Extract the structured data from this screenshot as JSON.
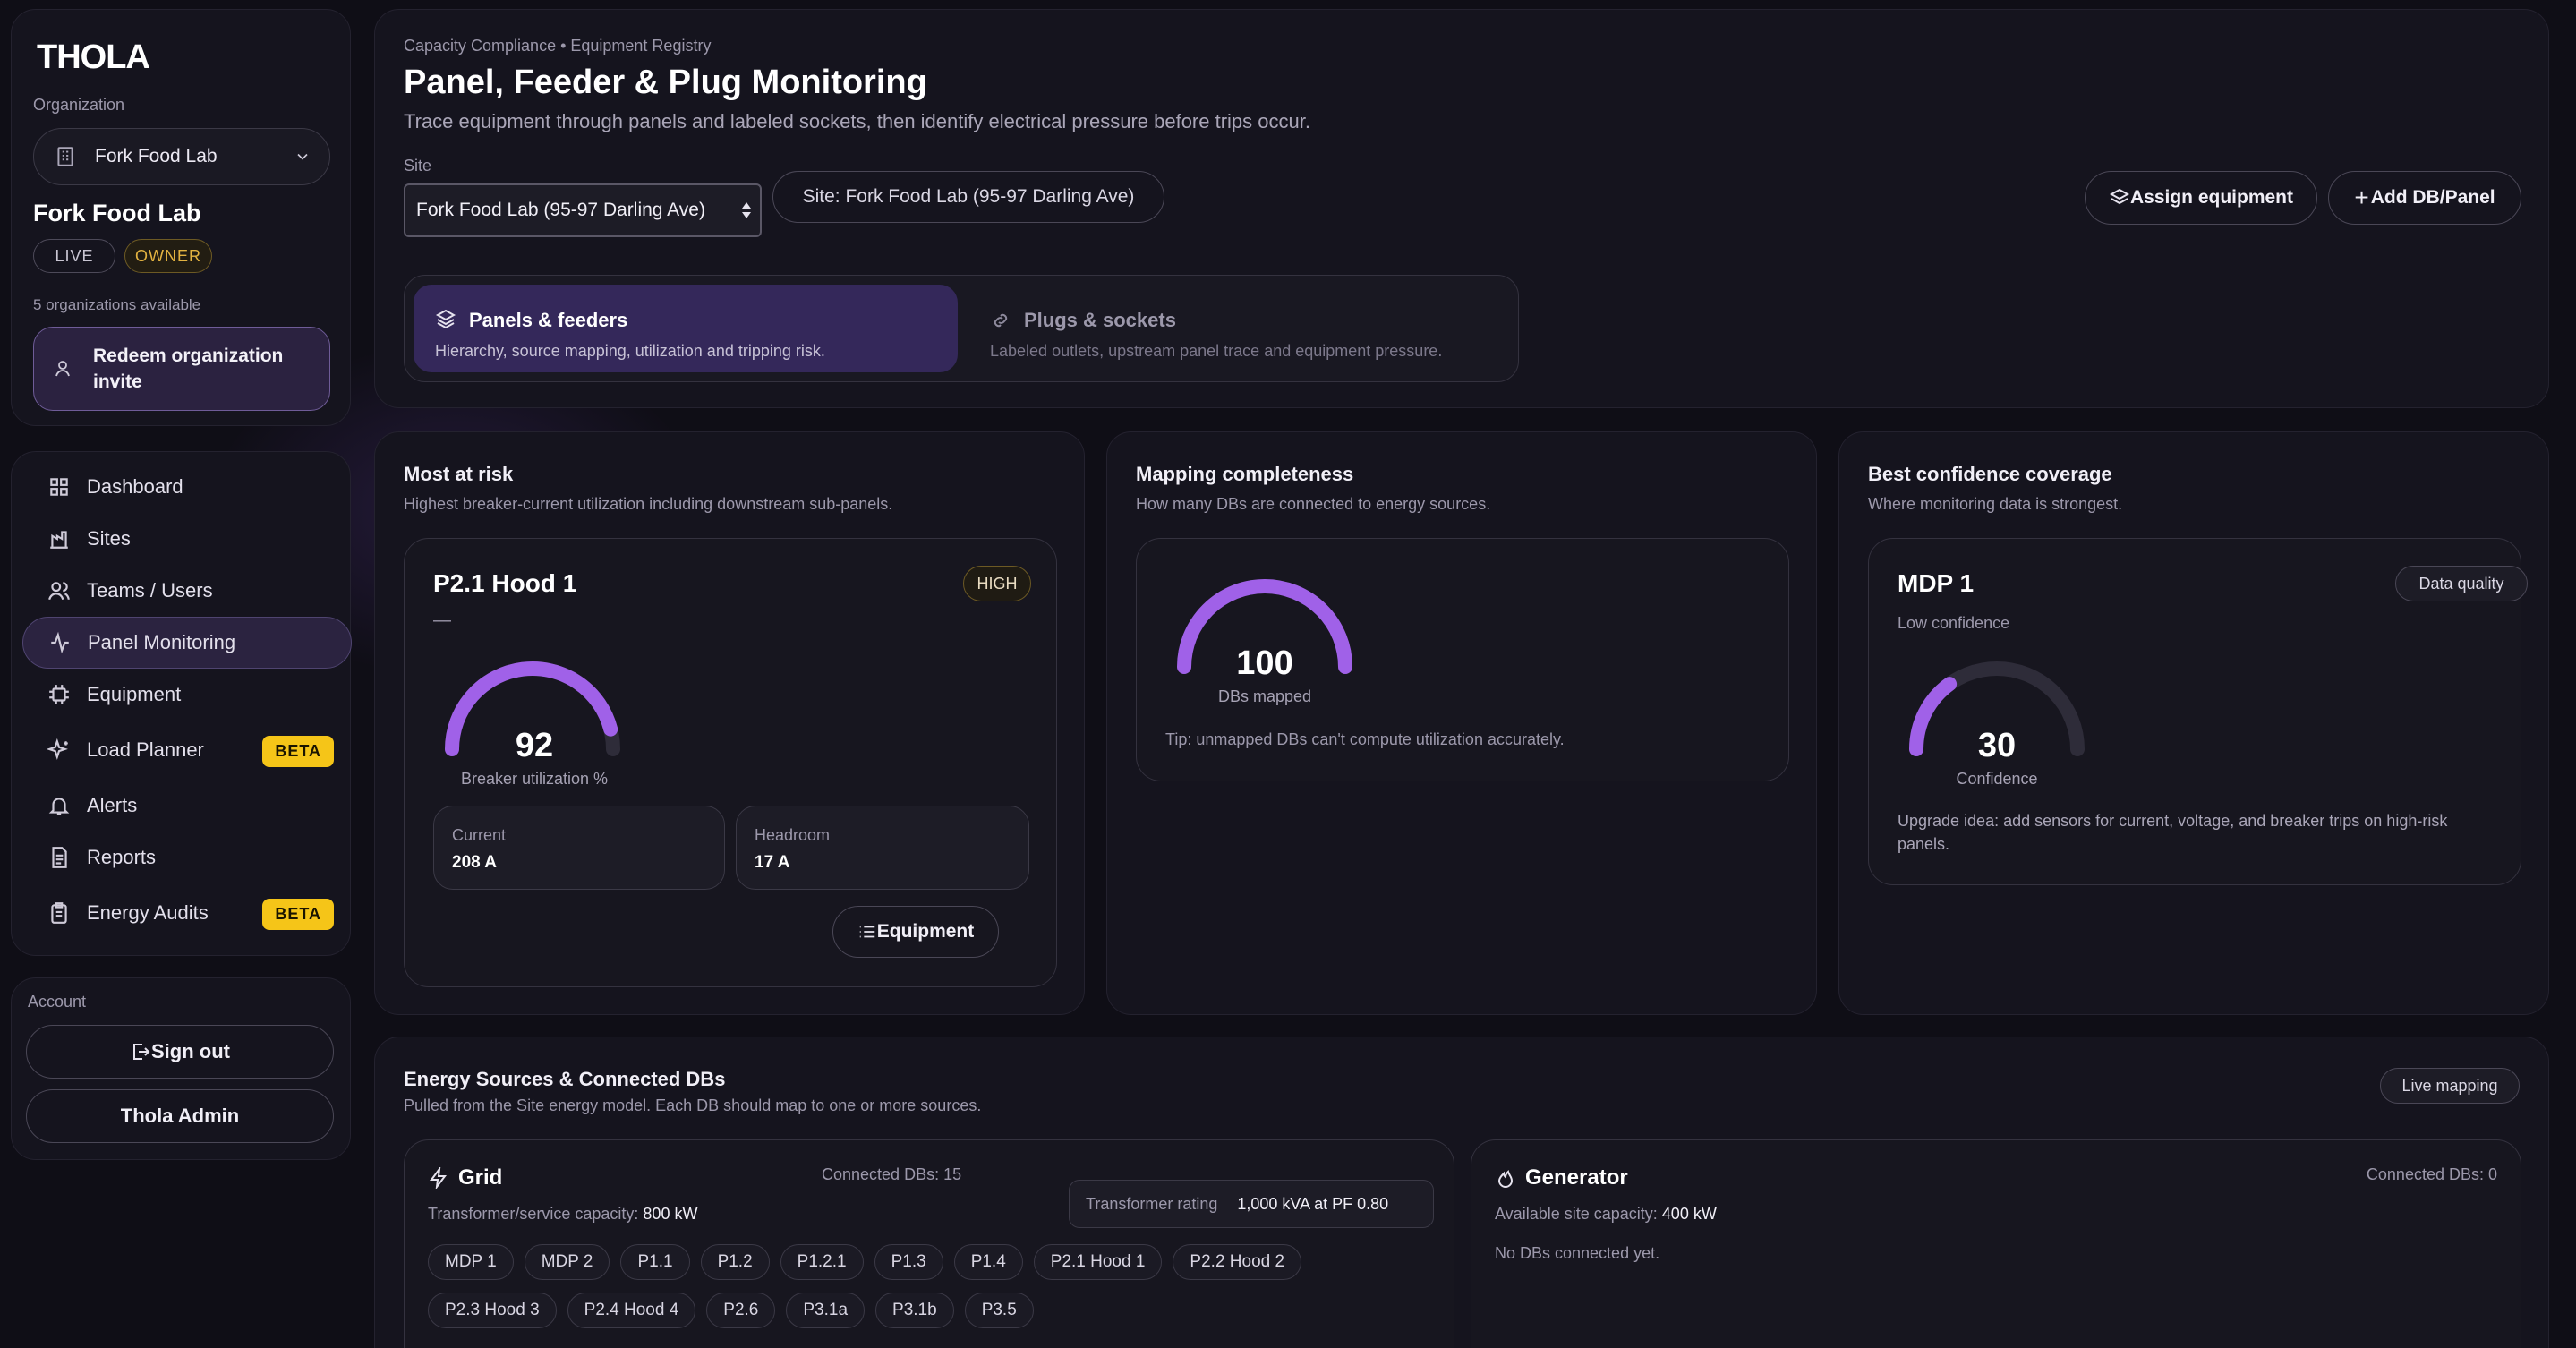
{
  "brand": {
    "logo_text": "THOLA"
  },
  "org": {
    "label": "Organization",
    "selected": "Fork Food Lab",
    "name": "Fork Food Lab",
    "badge_live": "LIVE",
    "badge_owner": "OWNER",
    "available": "5 organizations available",
    "redeem_label": "Redeem organization invite"
  },
  "nav": [
    {
      "label": "Dashboard",
      "icon": "grid-icon"
    },
    {
      "label": "Sites",
      "icon": "sites-icon"
    },
    {
      "label": "Teams / Users",
      "icon": "users-icon"
    },
    {
      "label": "Panel Monitoring",
      "icon": "activity-icon",
      "active": true
    },
    {
      "label": "Equipment",
      "icon": "equipment-icon"
    },
    {
      "label": "Load Planner",
      "icon": "sparkle-icon",
      "badge": "BETA"
    },
    {
      "label": "Alerts",
      "icon": "bell-icon"
    },
    {
      "label": "Reports",
      "icon": "report-icon"
    },
    {
      "label": "Energy Audits",
      "icon": "clipboard-icon",
      "badge": "BETA"
    }
  ],
  "account": {
    "label": "Account",
    "signout": "Sign out",
    "admin": "Thola Admin"
  },
  "header": {
    "breadcrumb": "Capacity Compliance • Equipment Registry",
    "title": "Panel, Feeder & Plug Monitoring",
    "subtitle": "Trace equipment through panels and labeled sockets, then identify electrical pressure before trips occur.",
    "site_label": "Site",
    "site_selected": "Fork Food Lab (95-97 Darling Ave)",
    "site_pill": "Site: Fork Food Lab (95-97 Darling Ave)",
    "assign_button": "Assign equipment",
    "add_button": "Add DB/Panel"
  },
  "tabs": [
    {
      "label": "Panels & feeders",
      "desc": "Hierarchy, source mapping, utilization and tripping risk.",
      "active": true
    },
    {
      "label": "Plugs & sockets",
      "desc": "Labeled outlets, upstream panel trace and equipment pressure."
    }
  ],
  "risk": {
    "title": "Most at risk",
    "subtitle": "Highest breaker-current utilization including downstream sub-panels.",
    "panel_name": "P2.1 Hood 1",
    "badge": "HIGH",
    "dash": "—",
    "value": "92",
    "fraction": 0.92,
    "caption": "Breaker utilization %",
    "current_label": "Current",
    "current_value": "208 A",
    "headroom_label": "Headroom",
    "headroom_value": "17 A",
    "equipment_button": "Equipment"
  },
  "mapping": {
    "title": "Mapping completeness",
    "subtitle": "How many DBs are connected to energy sources.",
    "value": "100",
    "fraction": 1.0,
    "caption": "DBs mapped",
    "tip": "Tip: unmapped DBs can't compute utilization accurately."
  },
  "confidence": {
    "title": "Best confidence coverage",
    "subtitle": "Where monitoring data is strongest.",
    "panel_name": "MDP 1",
    "badge": "Data quality",
    "level": "Low confidence",
    "value": "30",
    "fraction": 0.3,
    "caption": "Confidence",
    "upgrade": "Upgrade idea: add sensors for current, voltage, and breaker trips on high-risk panels."
  },
  "sources": {
    "title": "Energy Sources & Connected DBs",
    "subtitle": "Pulled from the Site energy model. Each DB should map to one or more sources.",
    "badge": "Live mapping",
    "grid": {
      "name": "Grid",
      "connected": "Connected DBs: 15",
      "capacity_label": "Transformer/service capacity:",
      "capacity_value": "800 kW",
      "rating_label": "Transformer rating",
      "rating_value": "1,000 kVA at PF 0.80",
      "dbs": [
        "MDP 1",
        "MDP 2",
        "P1.1",
        "P1.2",
        "P1.2.1",
        "P1.3",
        "P1.4",
        "P2.1 Hood 1",
        "P2.2 Hood 2",
        "P2.3 Hood 3",
        "P2.4 Hood 4",
        "P2.6",
        "P3.1a",
        "P3.1b",
        "P3.5"
      ]
    },
    "generator": {
      "name": "Generator",
      "connected": "Connected DBs: 0",
      "capacity_label": "Available site capacity:",
      "capacity_value": "400 kW",
      "empty": "No DBs connected yet."
    }
  },
  "colors": {
    "accent": "#a061e8",
    "track": "#2e2c39",
    "beta": "#f5c518",
    "owner": "#e3b341"
  }
}
